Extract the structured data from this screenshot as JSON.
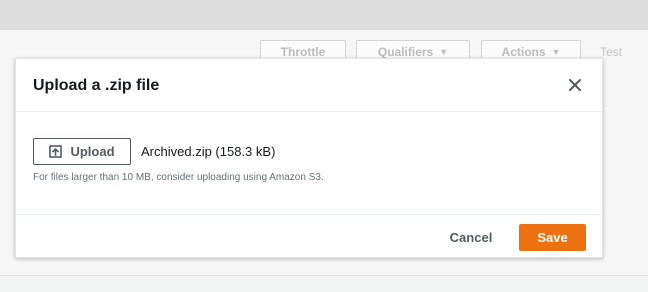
{
  "background": {
    "toolbar": {
      "throttle_label": "Throttle",
      "qualifiers_label": "Qualifiers",
      "actions_label": "Actions",
      "test_label": "Test"
    }
  },
  "modal": {
    "title": "Upload a .zip file",
    "upload_label": "Upload",
    "file_name": "Archived.zip (158.3 kB)",
    "hint": "For files larger than 10 MB, consider uploading using Amazon S3.",
    "cancel_label": "Cancel",
    "save_label": "Save"
  },
  "icons": {
    "close": "close-icon",
    "upload": "upload-icon",
    "dropdown": "caret-down-icon"
  },
  "colors": {
    "primary": "#ec7211",
    "text": "#16191f",
    "secondary_text": "#545b64",
    "hint_text": "#687078"
  }
}
